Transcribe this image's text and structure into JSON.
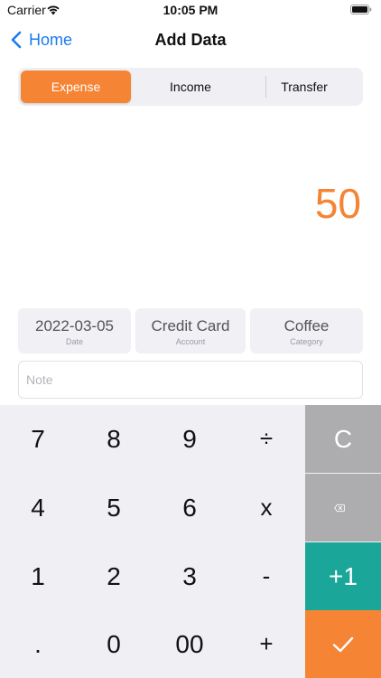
{
  "status_bar": {
    "carrier": "Carrier",
    "time": "10:05 PM"
  },
  "nav": {
    "back_label": "Home",
    "title": "Add Data"
  },
  "segments": [
    {
      "label": "Expense",
      "active": true
    },
    {
      "label": "Income",
      "active": false
    },
    {
      "label": "Transfer",
      "active": false
    }
  ],
  "amount": "50",
  "fields": {
    "date": {
      "value": "2022-03-05",
      "label": "Date"
    },
    "account": {
      "value": "Credit Card",
      "label": "Account"
    },
    "category": {
      "value": "Coffee",
      "label": "Category"
    }
  },
  "note": {
    "placeholder": "Note",
    "value": ""
  },
  "keypad": {
    "row1": [
      "7",
      "8",
      "9",
      "÷"
    ],
    "row2": [
      "4",
      "5",
      "6",
      "x"
    ],
    "row3": [
      "1",
      "2",
      "3",
      "-"
    ],
    "row4": [
      ".",
      "0",
      "00",
      "+"
    ],
    "clear": "C",
    "plus_one": "+1",
    "confirm": "✓"
  },
  "colors": {
    "accent": "#f58434",
    "link": "#1a7cf0",
    "teal": "#1aa79a",
    "gray_key": "#adadb0"
  },
  "icons": {
    "wifi": "wifi-icon",
    "battery": "battery-icon",
    "back": "chevron-left-icon",
    "backspace": "backspace-icon",
    "confirm": "checkmark-icon"
  }
}
